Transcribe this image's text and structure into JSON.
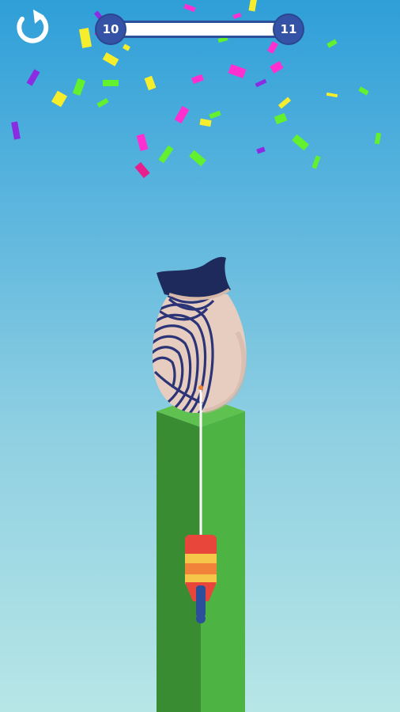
{
  "hud": {
    "restart_icon": "restart-arrow-icon",
    "level_current": "10",
    "level_next": "11",
    "level_progress": 0.0
  },
  "colors": {
    "sky_top": "#2f9fd8",
    "sky_bottom": "#b7e6e6",
    "pillar_light": "#4db443",
    "pillar_dark": "#3a8c33",
    "vase_body": "#e6cdbf",
    "vase_pattern": "#2c3478",
    "vase_opening": "#1e2a5c",
    "laser": "#ffffff",
    "cannon_orange": "#f0823a",
    "cannon_red": "#e8463a",
    "cannon_yellow": "#f6c64a",
    "cannon_handle": "#2c4f9b"
  },
  "confetti_colors": [
    "#ff2fd0",
    "#f6ee2d",
    "#63f02e",
    "#8b2be2",
    "#e81e8e"
  ]
}
